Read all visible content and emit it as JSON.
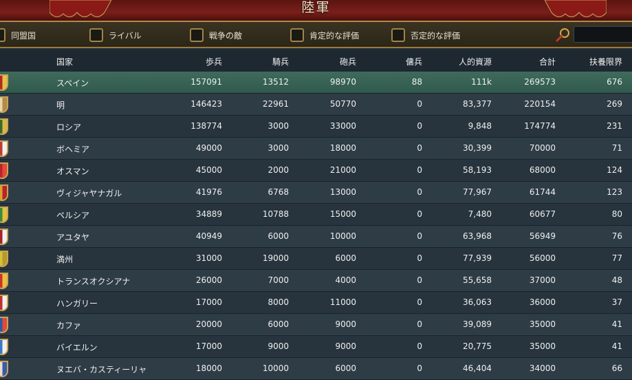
{
  "window": {
    "title": "陸軍"
  },
  "filters": [
    {
      "label": "同盟国"
    },
    {
      "label": "ライバル"
    },
    {
      "label": "戦争の敵"
    },
    {
      "label": "肯定的な評価"
    },
    {
      "label": "否定的な評価"
    }
  ],
  "search": {
    "placeholder": ""
  },
  "columns": [
    "国家",
    "歩兵",
    "騎兵",
    "砲兵",
    "傭兵",
    "人的資源",
    "合計",
    "扶養限界"
  ],
  "rows": [
    {
      "country": "スペイン",
      "infantry": "157091",
      "cavalry": "13512",
      "artillery": "98970",
      "mercenaries": "88",
      "manpower": "111k",
      "total": "269573",
      "force_limit": "676",
      "shield_colors": [
        "#b42a22",
        "#e3c14a"
      ]
    },
    {
      "country": "明",
      "infantry": "146423",
      "cavalry": "22961",
      "artillery": "50770",
      "mercenaries": "0",
      "manpower": "83,377",
      "total": "220154",
      "force_limit": "269",
      "shield_colors": [
        "#e9d7a8",
        "#b48a4a"
      ]
    },
    {
      "country": "ロシア",
      "infantry": "138774",
      "cavalry": "3000",
      "artillery": "33000",
      "mercenaries": "0",
      "manpower": "9,848",
      "total": "174774",
      "force_limit": "231",
      "shield_colors": [
        "#3c6a2a",
        "#d9b84a"
      ]
    },
    {
      "country": "ボヘミア",
      "infantry": "49000",
      "cavalry": "3000",
      "artillery": "18000",
      "mercenaries": "0",
      "manpower": "30,399",
      "total": "70000",
      "force_limit": "71",
      "shield_colors": [
        "#c23a2e",
        "#f0f0f0"
      ]
    },
    {
      "country": "オスマン",
      "infantry": "45000",
      "cavalry": "2000",
      "artillery": "21000",
      "mercenaries": "0",
      "manpower": "58,193",
      "total": "68000",
      "force_limit": "124",
      "shield_colors": [
        "#b8242a",
        "#e04a3a"
      ]
    },
    {
      "country": "ヴィジャヤナガル",
      "infantry": "41976",
      "cavalry": "6768",
      "artillery": "13000",
      "mercenaries": "0",
      "manpower": "77,967",
      "total": "61744",
      "force_limit": "123",
      "shield_colors": [
        "#d8a42a",
        "#b8242a"
      ]
    },
    {
      "country": "ペルシア",
      "infantry": "34889",
      "cavalry": "10788",
      "artillery": "15000",
      "mercenaries": "0",
      "manpower": "7,480",
      "total": "60677",
      "force_limit": "80",
      "shield_colors": [
        "#3a8a3a",
        "#e0c040"
      ]
    },
    {
      "country": "アユタヤ",
      "infantry": "40949",
      "cavalry": "6000",
      "artillery": "10000",
      "mercenaries": "0",
      "manpower": "63,968",
      "total": "56949",
      "force_limit": "76",
      "shield_colors": [
        "#a4242a",
        "#f0f0f0"
      ]
    },
    {
      "country": "満州",
      "infantry": "31000",
      "cavalry": "19000",
      "artillery": "6000",
      "mercenaries": "0",
      "manpower": "77,939",
      "total": "56000",
      "force_limit": "77",
      "shield_colors": [
        "#d8c03a",
        "#b89a2a"
      ]
    },
    {
      "country": "トランスオクシアナ",
      "infantry": "26000",
      "cavalry": "7000",
      "artillery": "4000",
      "mercenaries": "0",
      "manpower": "55,658",
      "total": "37000",
      "force_limit": "48",
      "shield_colors": [
        "#d0302a",
        "#e8c040"
      ]
    },
    {
      "country": "ハンガリー",
      "infantry": "17000",
      "cavalry": "8000",
      "artillery": "11000",
      "mercenaries": "0",
      "manpower": "36,063",
      "total": "36000",
      "force_limit": "37",
      "shield_colors": [
        "#c0302a",
        "#f0f0f0"
      ]
    },
    {
      "country": "カファ",
      "infantry": "20000",
      "cavalry": "6000",
      "artillery": "9000",
      "mercenaries": "0",
      "manpower": "39,089",
      "total": "35000",
      "force_limit": "41",
      "shield_colors": [
        "#2a5aa8",
        "#e04a3a"
      ]
    },
    {
      "country": "バイエルン",
      "infantry": "17000",
      "cavalry": "9000",
      "artillery": "9000",
      "mercenaries": "0",
      "manpower": "20,775",
      "total": "35000",
      "force_limit": "41",
      "shield_colors": [
        "#3a78c8",
        "#f0f0f0"
      ]
    },
    {
      "country": "ヌエバ・カスティーリャ",
      "infantry": "18000",
      "cavalry": "10000",
      "artillery": "6000",
      "mercenaries": "0",
      "manpower": "46,404",
      "total": "34000",
      "force_limit": "66",
      "shield_colors": [
        "#e8e0c8",
        "#3a5ab0"
      ]
    }
  ],
  "colors": {
    "selected_row": "#3f6a5c",
    "header_bg": "#1e2830",
    "title_bg": "#7a1f1a",
    "gold_border": "#b48a4a"
  }
}
